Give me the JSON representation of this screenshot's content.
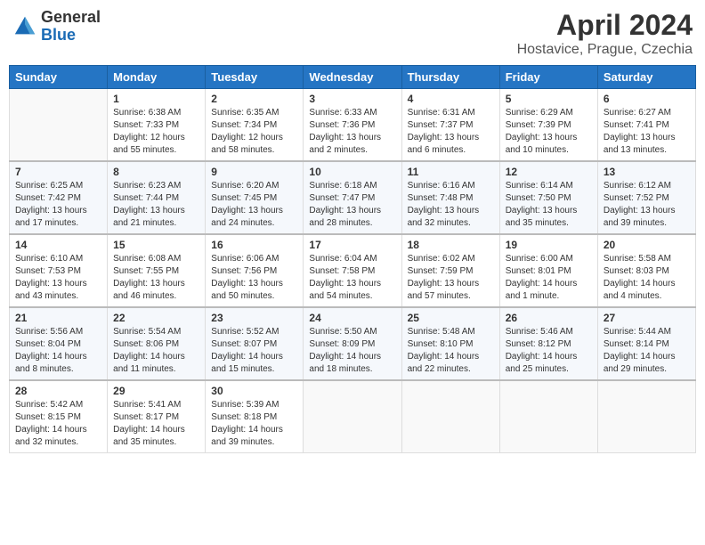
{
  "header": {
    "logo_general": "General",
    "logo_blue": "Blue",
    "month_title": "April 2024",
    "location": "Hostavice, Prague, Czechia"
  },
  "weekdays": [
    "Sunday",
    "Monday",
    "Tuesday",
    "Wednesday",
    "Thursday",
    "Friday",
    "Saturday"
  ],
  "weeks": [
    [
      {
        "day": "",
        "info": ""
      },
      {
        "day": "1",
        "info": "Sunrise: 6:38 AM\nSunset: 7:33 PM\nDaylight: 12 hours\nand 55 minutes."
      },
      {
        "day": "2",
        "info": "Sunrise: 6:35 AM\nSunset: 7:34 PM\nDaylight: 12 hours\nand 58 minutes."
      },
      {
        "day": "3",
        "info": "Sunrise: 6:33 AM\nSunset: 7:36 PM\nDaylight: 13 hours\nand 2 minutes."
      },
      {
        "day": "4",
        "info": "Sunrise: 6:31 AM\nSunset: 7:37 PM\nDaylight: 13 hours\nand 6 minutes."
      },
      {
        "day": "5",
        "info": "Sunrise: 6:29 AM\nSunset: 7:39 PM\nDaylight: 13 hours\nand 10 minutes."
      },
      {
        "day": "6",
        "info": "Sunrise: 6:27 AM\nSunset: 7:41 PM\nDaylight: 13 hours\nand 13 minutes."
      }
    ],
    [
      {
        "day": "7",
        "info": "Sunrise: 6:25 AM\nSunset: 7:42 PM\nDaylight: 13 hours\nand 17 minutes."
      },
      {
        "day": "8",
        "info": "Sunrise: 6:23 AM\nSunset: 7:44 PM\nDaylight: 13 hours\nand 21 minutes."
      },
      {
        "day": "9",
        "info": "Sunrise: 6:20 AM\nSunset: 7:45 PM\nDaylight: 13 hours\nand 24 minutes."
      },
      {
        "day": "10",
        "info": "Sunrise: 6:18 AM\nSunset: 7:47 PM\nDaylight: 13 hours\nand 28 minutes."
      },
      {
        "day": "11",
        "info": "Sunrise: 6:16 AM\nSunset: 7:48 PM\nDaylight: 13 hours\nand 32 minutes."
      },
      {
        "day": "12",
        "info": "Sunrise: 6:14 AM\nSunset: 7:50 PM\nDaylight: 13 hours\nand 35 minutes."
      },
      {
        "day": "13",
        "info": "Sunrise: 6:12 AM\nSunset: 7:52 PM\nDaylight: 13 hours\nand 39 minutes."
      }
    ],
    [
      {
        "day": "14",
        "info": "Sunrise: 6:10 AM\nSunset: 7:53 PM\nDaylight: 13 hours\nand 43 minutes."
      },
      {
        "day": "15",
        "info": "Sunrise: 6:08 AM\nSunset: 7:55 PM\nDaylight: 13 hours\nand 46 minutes."
      },
      {
        "day": "16",
        "info": "Sunrise: 6:06 AM\nSunset: 7:56 PM\nDaylight: 13 hours\nand 50 minutes."
      },
      {
        "day": "17",
        "info": "Sunrise: 6:04 AM\nSunset: 7:58 PM\nDaylight: 13 hours\nand 54 minutes."
      },
      {
        "day": "18",
        "info": "Sunrise: 6:02 AM\nSunset: 7:59 PM\nDaylight: 13 hours\nand 57 minutes."
      },
      {
        "day": "19",
        "info": "Sunrise: 6:00 AM\nSunset: 8:01 PM\nDaylight: 14 hours\nand 1 minute."
      },
      {
        "day": "20",
        "info": "Sunrise: 5:58 AM\nSunset: 8:03 PM\nDaylight: 14 hours\nand 4 minutes."
      }
    ],
    [
      {
        "day": "21",
        "info": "Sunrise: 5:56 AM\nSunset: 8:04 PM\nDaylight: 14 hours\nand 8 minutes."
      },
      {
        "day": "22",
        "info": "Sunrise: 5:54 AM\nSunset: 8:06 PM\nDaylight: 14 hours\nand 11 minutes."
      },
      {
        "day": "23",
        "info": "Sunrise: 5:52 AM\nSunset: 8:07 PM\nDaylight: 14 hours\nand 15 minutes."
      },
      {
        "day": "24",
        "info": "Sunrise: 5:50 AM\nSunset: 8:09 PM\nDaylight: 14 hours\nand 18 minutes."
      },
      {
        "day": "25",
        "info": "Sunrise: 5:48 AM\nSunset: 8:10 PM\nDaylight: 14 hours\nand 22 minutes."
      },
      {
        "day": "26",
        "info": "Sunrise: 5:46 AM\nSunset: 8:12 PM\nDaylight: 14 hours\nand 25 minutes."
      },
      {
        "day": "27",
        "info": "Sunrise: 5:44 AM\nSunset: 8:14 PM\nDaylight: 14 hours\nand 29 minutes."
      }
    ],
    [
      {
        "day": "28",
        "info": "Sunrise: 5:42 AM\nSunset: 8:15 PM\nDaylight: 14 hours\nand 32 minutes."
      },
      {
        "day": "29",
        "info": "Sunrise: 5:41 AM\nSunset: 8:17 PM\nDaylight: 14 hours\nand 35 minutes."
      },
      {
        "day": "30",
        "info": "Sunrise: 5:39 AM\nSunset: 8:18 PM\nDaylight: 14 hours\nand 39 minutes."
      },
      {
        "day": "",
        "info": ""
      },
      {
        "day": "",
        "info": ""
      },
      {
        "day": "",
        "info": ""
      },
      {
        "day": "",
        "info": ""
      }
    ]
  ]
}
